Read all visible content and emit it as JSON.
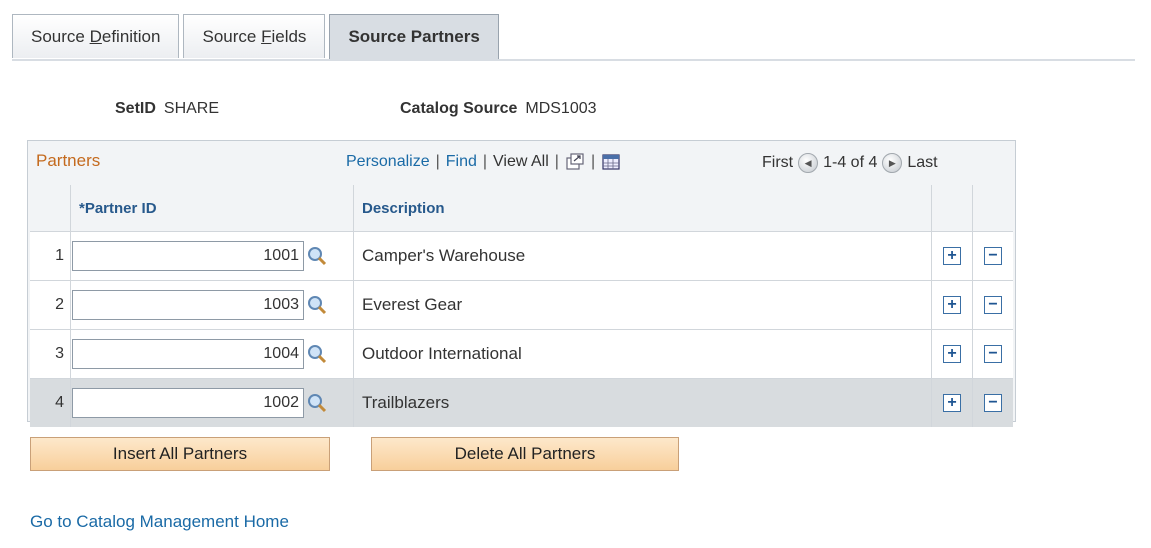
{
  "tabs": [
    {
      "pre": "Source ",
      "ul": "D",
      "post": "efinition"
    },
    {
      "pre": "Source ",
      "ul": "F",
      "post": "ields"
    },
    {
      "label": "Source Partners"
    }
  ],
  "header": {
    "setid_label": "SetID",
    "setid_value": "SHARE",
    "catalog_label": "Catalog Source",
    "catalog_value": "MDS1003"
  },
  "grid": {
    "title": "Partners",
    "personalize": "Personalize",
    "find": "Find",
    "view_all": "View All",
    "first": "First",
    "range": "1-4 of 4",
    "last": "Last",
    "col_partner": "*Partner ID",
    "col_desc": "Description",
    "rows": [
      {
        "n": "1",
        "id": "1001",
        "desc": "Camper's Warehouse"
      },
      {
        "n": "2",
        "id": "1003",
        "desc": "Everest Gear"
      },
      {
        "n": "3",
        "id": "1004",
        "desc": "Outdoor International"
      },
      {
        "n": "4",
        "id": "1002",
        "desc": "Trailblazers"
      }
    ]
  },
  "buttons": {
    "insert": "Insert All Partners",
    "delete": "Delete All Partners"
  },
  "link": "Go to Catalog Management Home",
  "icons": {
    "add": "+",
    "remove": "−"
  },
  "colors": {
    "title": "#c46a1e",
    "link": "#1a6aa6",
    "header_text": "#27598c",
    "button": "#f8cf9b"
  }
}
